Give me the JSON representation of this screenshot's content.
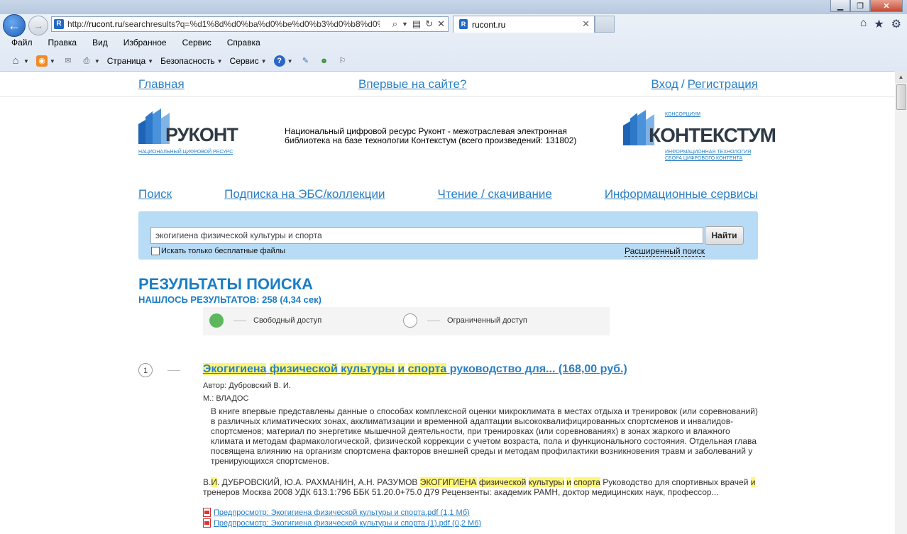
{
  "browser": {
    "address_host": "rucont.ru",
    "address_url_prefix": "http://",
    "address_url_rest": "/searchresults?q=%d1%8d%d0%ba%d0%be%d0%b3%d0%b8%d0%b3",
    "tab_title": "rucont.ru",
    "menu": [
      "Файл",
      "Правка",
      "Вид",
      "Избранное",
      "Сервис",
      "Справка"
    ],
    "commands": {
      "page": "Страница",
      "security": "Безопасность",
      "tools": "Сервис"
    }
  },
  "site": {
    "top_links": {
      "home": "Главная",
      "first_time": "Впервые на сайте?",
      "login": "Вход",
      "separator": "/",
      "register": "Регистрация"
    },
    "logo_rucont": {
      "name": "РУКОНТ",
      "sub": "НАЦИОНАЛЬНЫЙ ЦИФРОВОЙ РЕСУРС"
    },
    "header_text": "Национальный цифровой ресурс Руконт - межотраслевая электронная библиотека на базе технологии Контекстум (всего произведений: 131802)",
    "logo_context": {
      "top": "КОНСОРЦИУМ",
      "name": "КОНТЕКСТУМ",
      "sub1": "ИНФОРМАЦИОННАЯ ТЕХНОЛОГИЯ",
      "sub2": "СБОРА ЦИФРОВОГО КОНТЕНТА"
    },
    "main_nav": [
      "Поиск",
      "Подписка на ЭБС/коллекции",
      "Чтение / скачивание",
      "Информационные сервисы"
    ],
    "search": {
      "query": "экогигиена физической культуры и спорта",
      "button": "Найти",
      "free_only": "Искать только бесплатные файлы",
      "advanced": "Расширенный поиск"
    },
    "results": {
      "title": "РЕЗУЛЬТАТЫ ПОИСКА",
      "found_label": "НАШЛОСЬ РЕЗУЛЬТАТОВ:",
      "found_value": "258 (4,34 сек)",
      "legend_free": "Свободный доступ",
      "legend_limited": "Ограниченный доступ",
      "colors": {
        "free": "#5cb85c",
        "accent": "#1a7dc4",
        "highlight": "#fdf57a"
      },
      "items": [
        {
          "number": "1",
          "title_parts": [
            "Экогигиена",
            "физической",
            "культуры",
            "и",
            "спорта"
          ],
          "title_rest": "руководство для... (168,00 руб.)",
          "author": "Автор: Дубровский В. И.",
          "publisher": "М.: ВЛАДОС",
          "description": "В книге впервые представлены данные о способах комплексной оценки микроклимата в местах отдыха и тренировок (или соревнований) в различных климатических зонах, акклиматизации и временной адаптации высококвалифицированных спортсменов и инвалидов-спортсменов; материал по энергетике мышечной деятельности, при тренировках (или соревнованиях) в зонах жаркого и влажного климата и методам фармакологической, физической коррекции с учетом возраста, пола и функционального состояния. Отдельная глава посвящена влиянию на организм спортсмена факторов внешней среды и методам профилактики возникновения травм и заболеваний у тренирующихся спортсменов.",
          "snippet": {
            "p1": "В.",
            "h1": "И",
            "p2": ". ДУБРОВСКИЙ, Ю.А. РАХМАНИН, А.Н. РАЗУМОВ",
            "h2": "ЭКОГИГИЕНА",
            "h3": "физической",
            "h4": "культуры",
            "h5": "и",
            "h6": "спорта",
            "p3": "Руководство для спортивных врачей",
            "h7": "и",
            "p4": "тренеров Москва 2008 УДК 613.1:796 ББК 51.20.0+75.0 Д79 Рецензенты: академик РАМН, доктор медицинских наук, профессор..."
          },
          "files": [
            "Предпросмотр: Экогигиена физической культуры и спорта.pdf (1,1 Мб)",
            "Предпросмотр: Экогигиена физической культуры и спорта (1).pdf (0,2 Мб)"
          ]
        }
      ]
    }
  }
}
